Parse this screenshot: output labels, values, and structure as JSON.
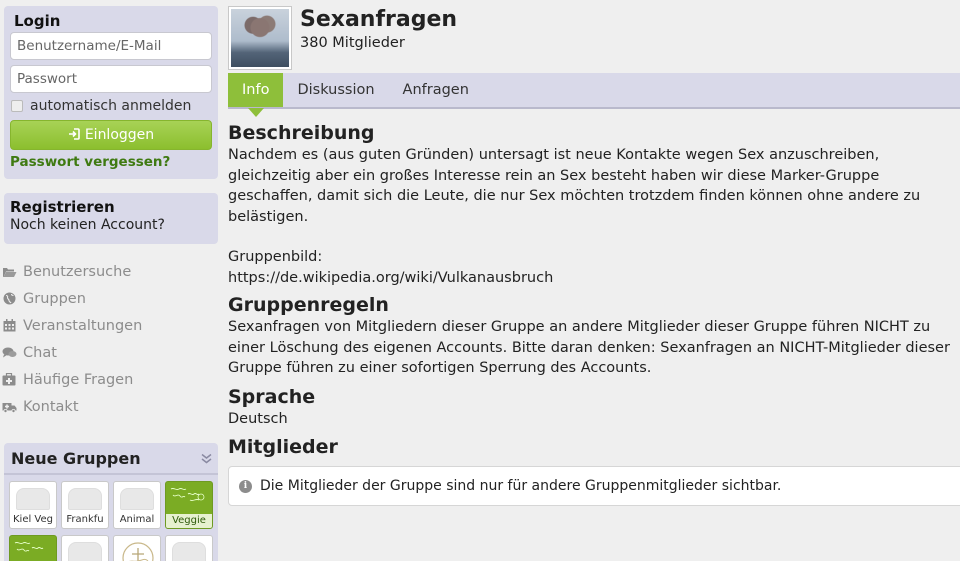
{
  "login": {
    "title": "Login",
    "username_placeholder": "Benutzername/E-Mail",
    "password_placeholder": "Passwort",
    "remember_label": "automatisch anmelden",
    "login_button": "Einloggen",
    "forgot_link": "Passwort vergessen?"
  },
  "register": {
    "title": "Registrieren",
    "subtitle": "Noch keinen Account?"
  },
  "nav": [
    {
      "label": "Benutzersuche",
      "icon": "folder-open-icon"
    },
    {
      "label": "Gruppen",
      "icon": "globe-icon"
    },
    {
      "label": "Veranstaltungen",
      "icon": "calendar-icon"
    },
    {
      "label": "Chat",
      "icon": "chat-bubbles-icon"
    },
    {
      "label": "Häufige Fragen",
      "icon": "first-aid-icon"
    },
    {
      "label": "Kontakt",
      "icon": "ambulance-icon"
    }
  ],
  "new_groups": {
    "title": "Neue Gruppen",
    "items": [
      {
        "label": "Kiel Veg"
      },
      {
        "label": "Frankfu"
      },
      {
        "label": "Animal"
      },
      {
        "label": "Veggie"
      }
    ]
  },
  "group": {
    "name": "Sexanfragen",
    "members_count": "380 Mitglieder"
  },
  "tabs": [
    {
      "label": "Info",
      "active": true
    },
    {
      "label": "Diskussion",
      "active": false
    },
    {
      "label": "Anfragen",
      "active": false
    }
  ],
  "sections": {
    "description_heading": "Beschreibung",
    "description_text": "Nachdem es (aus guten Gründen) untersagt ist neue Kontakte wegen Sex anzuschreiben, gleichzeitig aber ein großes Interesse rein an Sex besteht haben wir diese Marker-Gruppe geschaffen, damit sich die Leute, die nur Sex möchten trotzdem finden können ohne andere zu belästigen.",
    "image_label": "Gruppenbild:",
    "image_url": "https://de.wikipedia.org/wiki/Vulkanausbruch",
    "rules_heading": "Gruppenregeln",
    "rules_text": "Sexanfragen von Mitgliedern dieser Gruppe an andere Mitglieder dieser Gruppe führen NICHT zu einer Löschung des eigenen Accounts. Bitte daran denken: Sexanfragen an NICHT-Mitglieder dieser Gruppe führen zu einer sofortigen Sperrung des Accounts.",
    "language_heading": "Sprache",
    "language_text": "Deutsch",
    "members_heading": "Mitglieder",
    "members_notice": "Die Mitglieder der Gruppe sind nur für andere Gruppenmitglieder sichtbar."
  },
  "colors": {
    "accent_green": "#8ebf3a",
    "panel": "#d9d9e9",
    "link_green": "#3f7a12"
  }
}
